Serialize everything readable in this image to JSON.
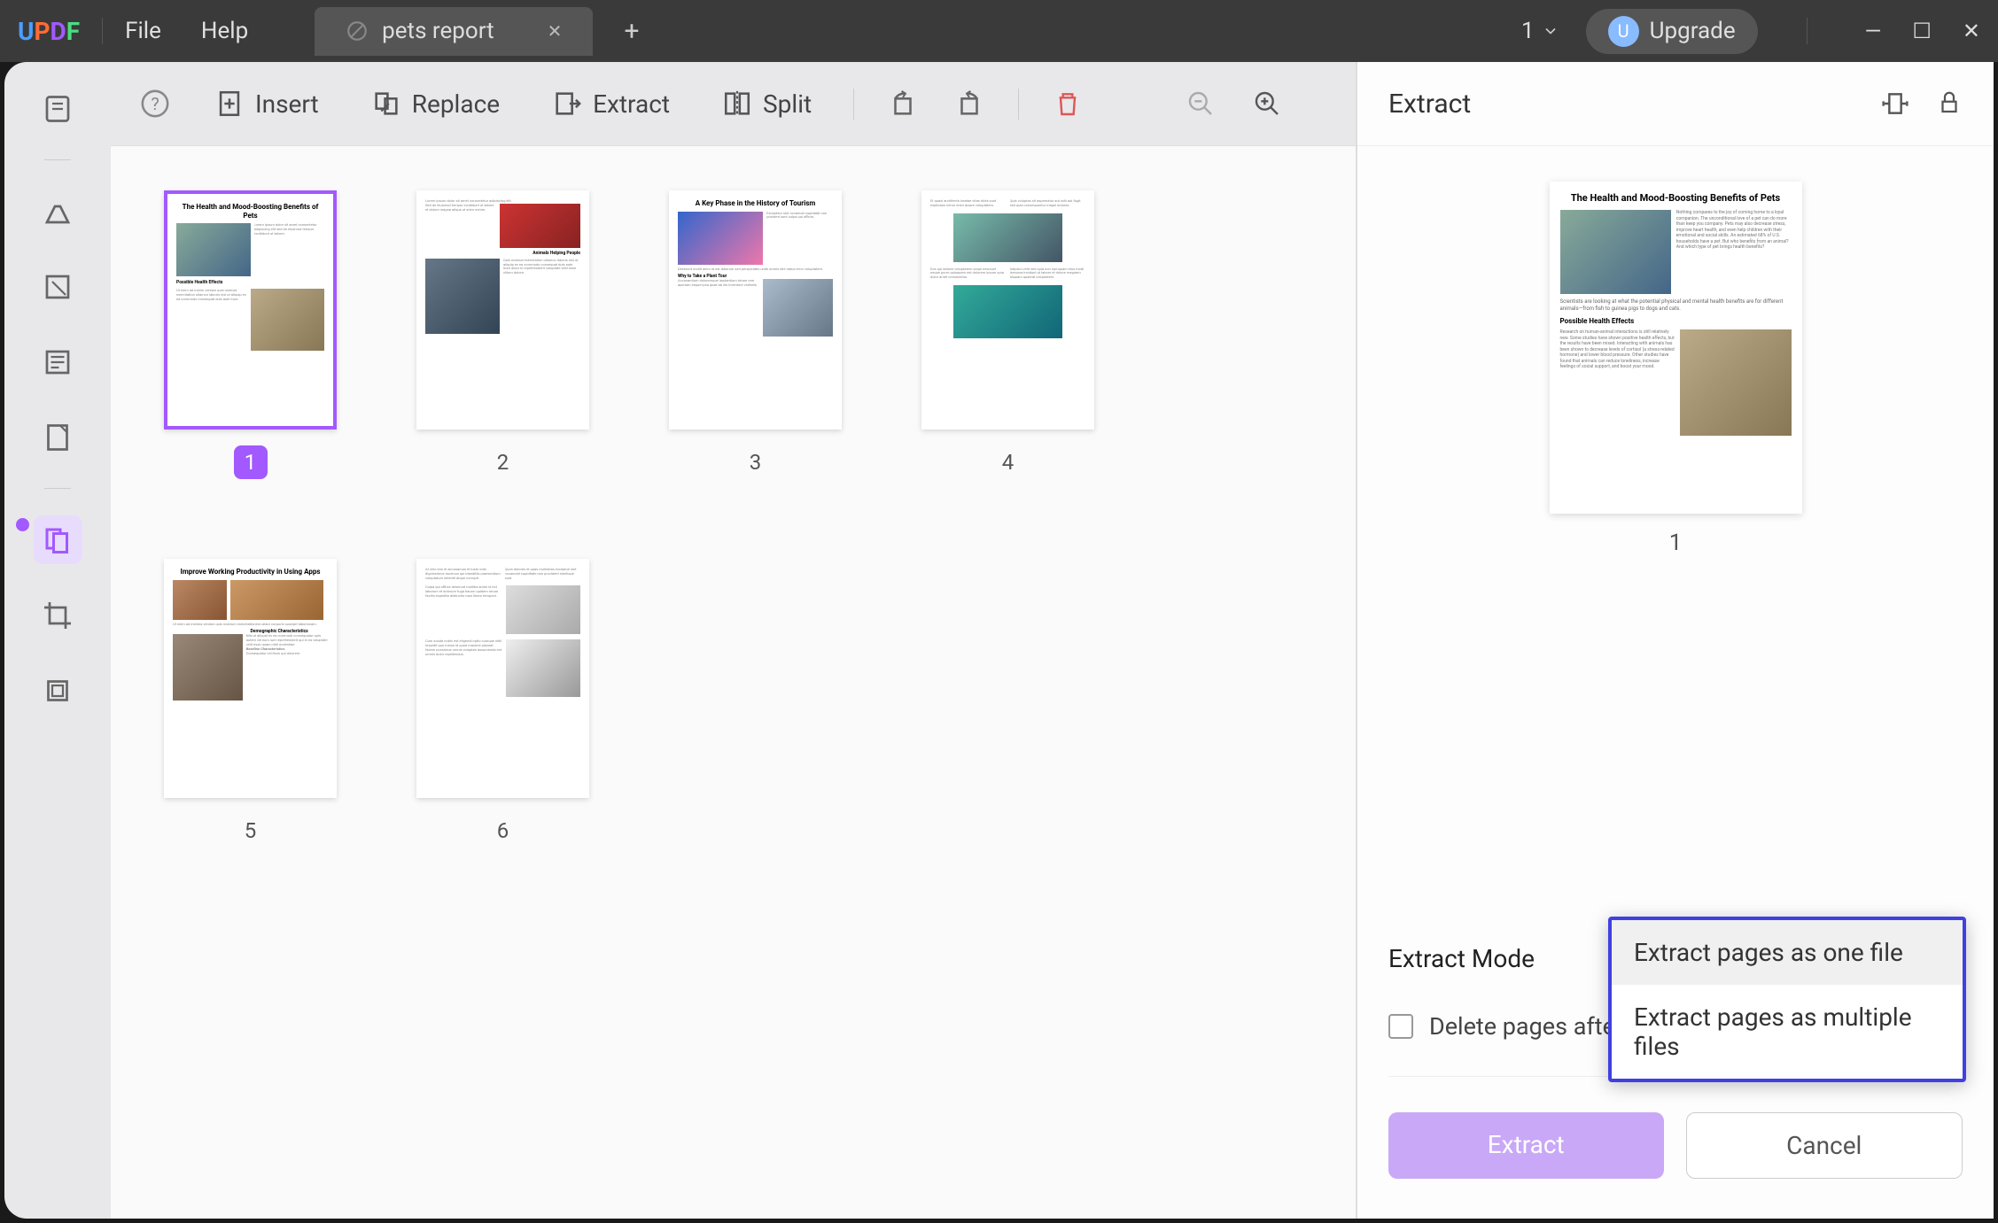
{
  "app": {
    "logo": "UPDF"
  },
  "menu": {
    "file": "File",
    "help": "Help"
  },
  "tab": {
    "title": "pets report"
  },
  "titlebar": {
    "page_count": "1",
    "upgrade": "Upgrade",
    "avatar_letter": "U"
  },
  "toolbar": {
    "insert": "Insert",
    "replace": "Replace",
    "extract": "Extract",
    "split": "Split"
  },
  "pages": [
    {
      "num": "1",
      "title": "The Health and Mood-Boosting Benefits of Pets",
      "selected": true
    },
    {
      "num": "2",
      "title": "Animals Helping People",
      "selected": false
    },
    {
      "num": "3",
      "title": "A Key Phase in the History of Tourism",
      "selected": false
    },
    {
      "num": "4",
      "title": "",
      "selected": false
    },
    {
      "num": "5",
      "title": "Improve Working Productivity in Using Apps",
      "selected": false
    },
    {
      "num": "6",
      "title": "",
      "selected": false
    }
  ],
  "right_panel": {
    "title": "Extract",
    "preview": {
      "num": "1",
      "title": "The Health and Mood-Boosting Benefits of Pets",
      "sub": "Possible Health Effects"
    },
    "mode_label": "Extract Mode",
    "mode_selected": "Extract pages as one file",
    "mode_options": [
      "Extract pages as one file",
      "Extract pages as multiple files"
    ],
    "delete_after": "Delete pages after extraction",
    "extract_btn": "Extract",
    "cancel_btn": "Cancel"
  },
  "colors": {
    "accent": "#a259ff",
    "highlight_border": "#4040e0"
  }
}
